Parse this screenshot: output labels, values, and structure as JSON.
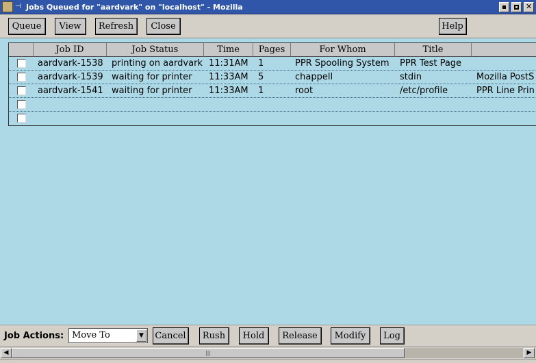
{
  "window": {
    "title": "Jobs Queued for \"aardvark\" on \"localhost\" - Mozilla"
  },
  "toolbar": {
    "queue_label": "Queue",
    "view_label": "View",
    "refresh_label": "Refresh",
    "close_label": "Close",
    "help_label": "Help"
  },
  "table": {
    "columns": [
      "Job ID",
      "Job Status",
      "Time",
      "Pages",
      "For Whom",
      "Title",
      ""
    ],
    "rows": [
      [
        "aardvark-1538",
        "printing on aardvark",
        "11:31AM",
        "1",
        "PPR Spooling System",
        "PPR Test Page",
        ""
      ],
      [
        "aardvark-1539",
        "waiting for printer",
        "11:33AM",
        "5",
        "chappell",
        "stdin",
        "Mozilla PostS"
      ],
      [
        "aardvark-1541",
        "waiting for printer",
        "11:33AM",
        "1",
        "root",
        "/etc/profile",
        "PPR Line Prin"
      ],
      [
        "",
        "",
        "",
        "",
        "",
        "",
        ""
      ],
      [
        "",
        "",
        "",
        "",
        "",
        "",
        ""
      ]
    ]
  },
  "job_actions": {
    "label": "Job Actions:",
    "move_to_value": "Move To",
    "cancel_label": "Cancel",
    "rush_label": "Rush",
    "hold_label": "Hold",
    "release_label": "Release",
    "modify_label": "Modify",
    "log_label": "Log"
  },
  "colors": {
    "content_background": "#add8e6",
    "title_bar": "#2f56a8"
  },
  "icons": {
    "app": "mozilla-app-icon",
    "pin": "pin-icon",
    "minimize": "minimize-icon",
    "maximize": "maximize-icon",
    "close": "close-icon",
    "dropdown": "chevron-down-icon",
    "scroll_left": "arrow-left-icon",
    "scroll_right": "arrow-right-icon"
  }
}
